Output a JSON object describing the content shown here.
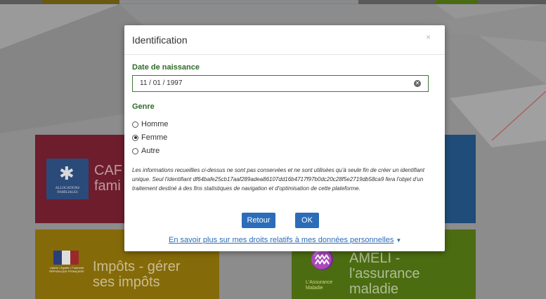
{
  "tiles": {
    "caf": {
      "text": "CAF\nfami",
      "logo_text": "ALLOCATIONS FAMILIALES"
    },
    "impots": {
      "text": "Impôts - gérer\nses impôts",
      "logo_text": "Liberté • Égalité • Fraternité RÉPUBLIQUE FRANÇAISE"
    },
    "ameli": {
      "text": "AMELI -\nl'assurance\nmaladie",
      "logo_text": "L'Assurance Maladie"
    }
  },
  "modal": {
    "title": "Identification",
    "close": "×",
    "birthdate_label": "Date de naissance",
    "birthdate_value": "11 / 01 / 1997",
    "gender_label": "Genre",
    "gender_options": [
      {
        "label": "Homme",
        "selected": false
      },
      {
        "label": "Femme",
        "selected": true
      },
      {
        "label": "Autre",
        "selected": false
      }
    ],
    "info_text": "Les informations recueillies ci-dessus ne sont pas conservées et ne sont utilisées qu'à seule fin de créer un identifiant unique. Seul l'identifiant df64bafe25cb17aaf289adea86107dd16b4717f97b0dc20c28f5e2719db58ca9 fera l'objet d'un traitement destiné à des fins statistiques de navigation et d'optimisation de cette plateforme.",
    "back_button": "Retour",
    "ok_button": "OK",
    "more_link": "En savoir plus sur mes droits relatifs à mes données personnelles"
  },
  "colors": {
    "accent_green": "#2f6b2a",
    "button_blue": "#2b6db8"
  }
}
